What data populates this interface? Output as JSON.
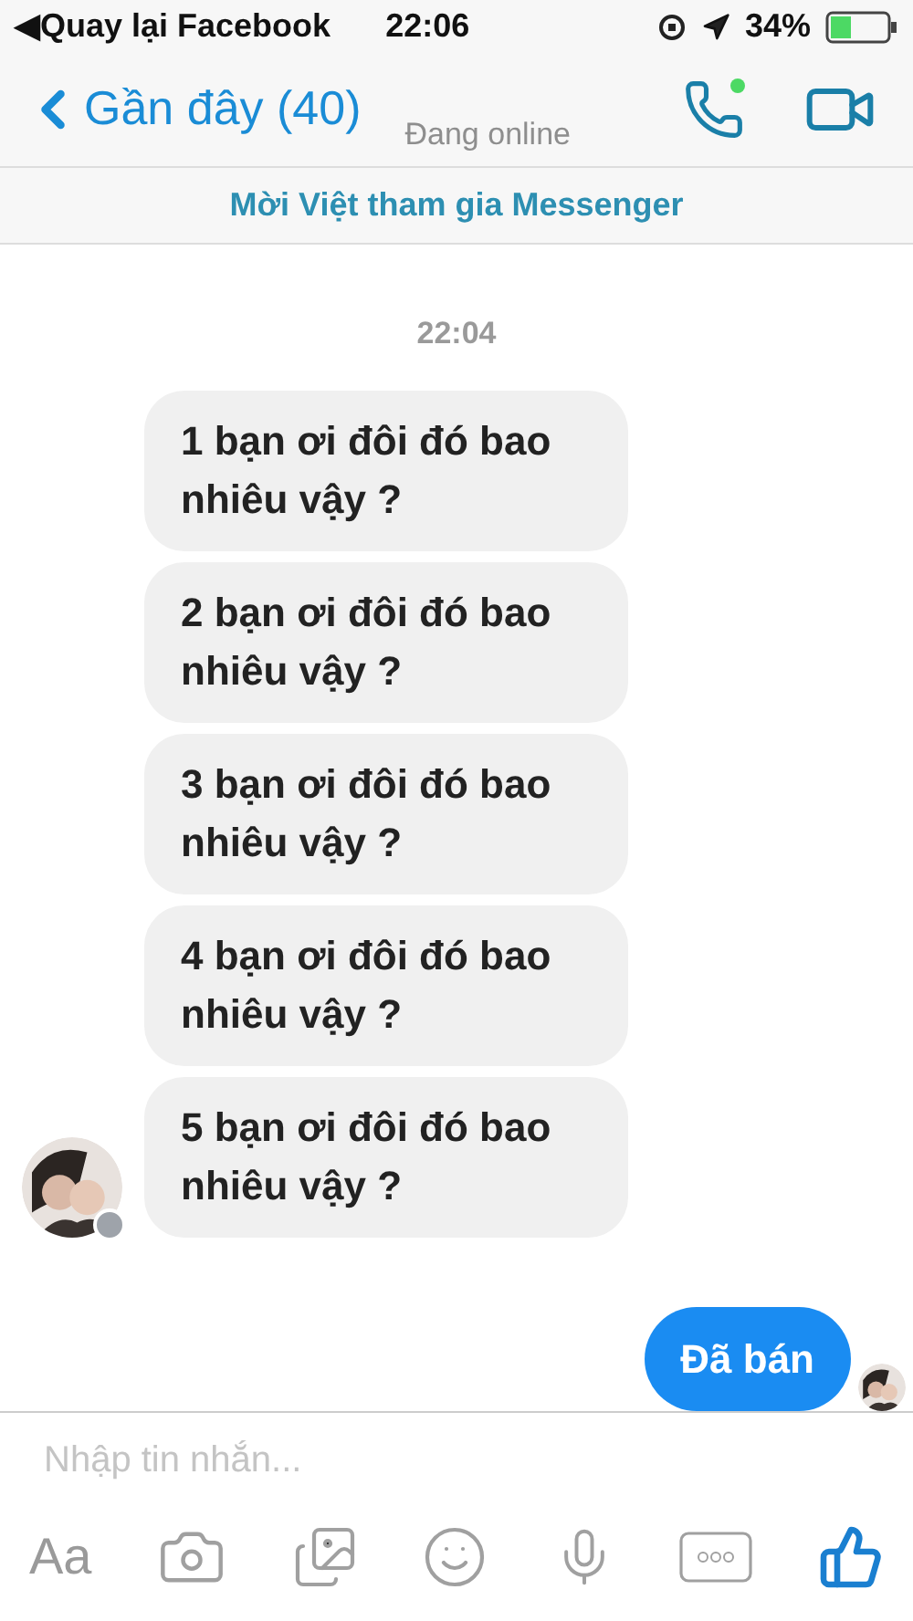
{
  "status_bar": {
    "back_arrow": "◀",
    "back_app": "Quay lại Facebook",
    "time": "22:06",
    "battery": "34%"
  },
  "header": {
    "back_label": "Gần đây (40)",
    "subtitle": "Đang online"
  },
  "banner": "Mời Việt tham gia Messenger",
  "timestamp": "22:04",
  "messages": [
    {
      "kind": "incoming",
      "text": "1 bạn ơi đôi đó bao nhiêu vậy ?",
      "show_avatar": false
    },
    {
      "kind": "incoming",
      "text": "2 bạn ơi đôi đó bao nhiêu vậy ?",
      "show_avatar": false
    },
    {
      "kind": "incoming",
      "text": "3 bạn ơi đôi đó bao nhiêu vậy ?",
      "show_avatar": false
    },
    {
      "kind": "incoming",
      "text": "4 bạn ơi đôi đó bao nhiêu vậy ?",
      "show_avatar": false
    },
    {
      "kind": "incoming",
      "text": "5 bạn ơi đôi đó bao nhiêu vậy ?",
      "show_avatar": true
    },
    {
      "kind": "outgoing",
      "text": "Đã bán",
      "show_avatar": true
    }
  ],
  "composer": {
    "placeholder": "Nhập tin nhắn...",
    "text_button": "Aa"
  }
}
